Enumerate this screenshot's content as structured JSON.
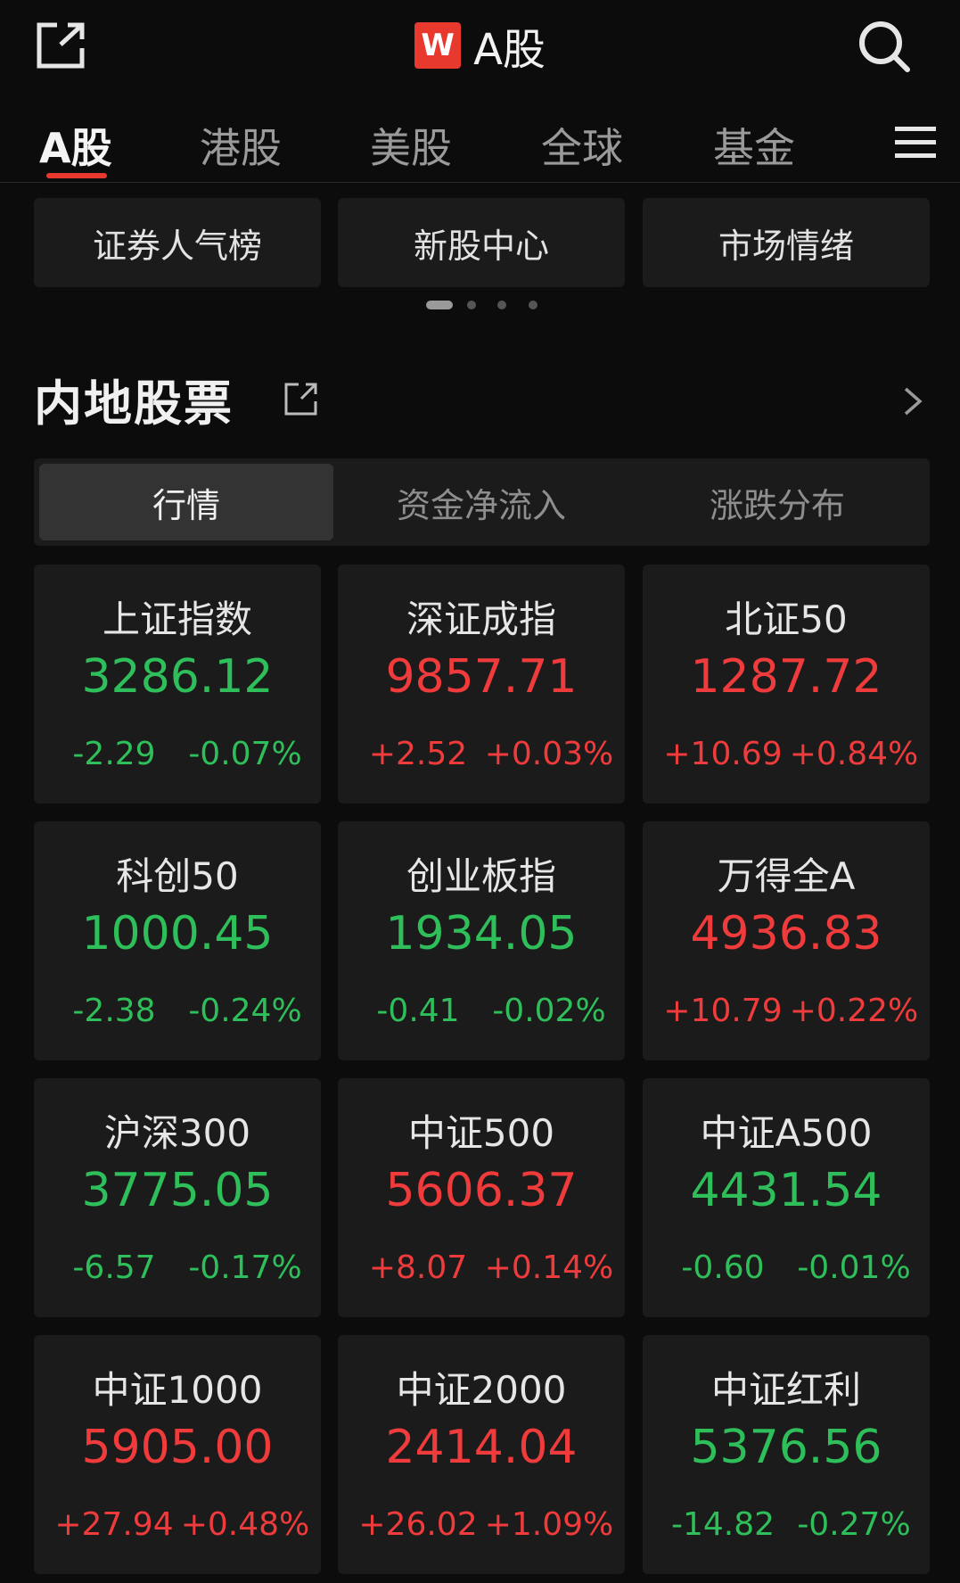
{
  "header": {
    "logo_letter": "W",
    "title": "A股",
    "share_icon": "share-out-icon",
    "search_icon": "search-icon"
  },
  "tabs": [
    {
      "label": "A股",
      "active": true
    },
    {
      "label": "港股",
      "active": false
    },
    {
      "label": "美股",
      "active": false
    },
    {
      "label": "全球",
      "active": false
    },
    {
      "label": "基金",
      "active": false
    }
  ],
  "quick_links": [
    "证券人气榜",
    "新股中心",
    "市场情绪"
  ],
  "pager": {
    "pages": 4,
    "current": 1
  },
  "section": {
    "title": "内地股票"
  },
  "segments": [
    {
      "label": "行情",
      "active": true
    },
    {
      "label": "资金净流入",
      "active": false
    },
    {
      "label": "涨跌分布",
      "active": false
    }
  ],
  "colors": {
    "up": "#ef3b3b",
    "down": "#2fbf5a",
    "accent": "#e8392f"
  },
  "indices": [
    {
      "name": "上证指数",
      "price": "3286.12",
      "change": "-2.29",
      "pct": "-0.07%",
      "dir": "down"
    },
    {
      "name": "深证成指",
      "price": "9857.71",
      "change": "+2.52",
      "pct": "+0.03%",
      "dir": "up"
    },
    {
      "name": "北证50",
      "price": "1287.72",
      "change": "+10.69",
      "pct": "+0.84%",
      "dir": "up"
    },
    {
      "name": "科创50",
      "price": "1000.45",
      "change": "-2.38",
      "pct": "-0.24%",
      "dir": "down"
    },
    {
      "name": "创业板指",
      "price": "1934.05",
      "change": "-0.41",
      "pct": "-0.02%",
      "dir": "down"
    },
    {
      "name": "万得全A",
      "price": "4936.83",
      "change": "+10.79",
      "pct": "+0.22%",
      "dir": "up"
    },
    {
      "name": "沪深300",
      "price": "3775.05",
      "change": "-6.57",
      "pct": "-0.17%",
      "dir": "down"
    },
    {
      "name": "中证500",
      "price": "5606.37",
      "change": "+8.07",
      "pct": "+0.14%",
      "dir": "up"
    },
    {
      "name": "中证A500",
      "price": "4431.54",
      "change": "-0.60",
      "pct": "-0.01%",
      "dir": "down"
    },
    {
      "name": "中证1000",
      "price": "5905.00",
      "change": "+27.94",
      "pct": "+0.48%",
      "dir": "up"
    },
    {
      "name": "中证2000",
      "price": "2414.04",
      "change": "+26.02",
      "pct": "+1.09%",
      "dir": "up"
    },
    {
      "name": "中证红利",
      "price": "5376.56",
      "change": "-14.82",
      "pct": "-0.27%",
      "dir": "down"
    }
  ]
}
